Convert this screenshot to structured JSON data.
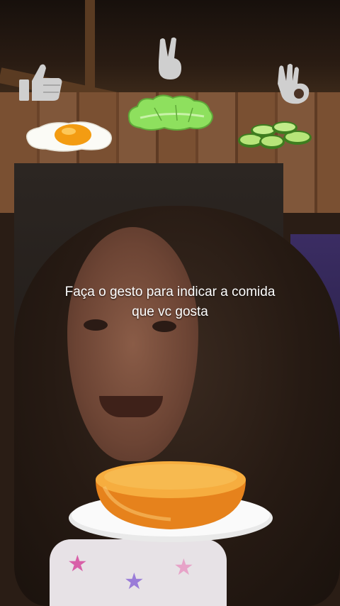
{
  "prompt": {
    "line1": "Faça o gesto para indicar a comida",
    "line2": "que vc gosta"
  },
  "food_options": [
    {
      "food": "fried-egg",
      "gesture": "thumbs-up-icon"
    },
    {
      "food": "lettuce",
      "gesture": "peace-sign-icon"
    },
    {
      "food": "cucumber-slices",
      "gesture": "ok-hand-icon"
    }
  ],
  "plate_item": "burger-bun-bottom",
  "colors": {
    "egg_yolk": "#f39c12",
    "lettuce": "#7ed957",
    "cucumber": "#8fd14f",
    "bun": "#f29a2e",
    "gesture_icon": "#c9c9c9"
  }
}
